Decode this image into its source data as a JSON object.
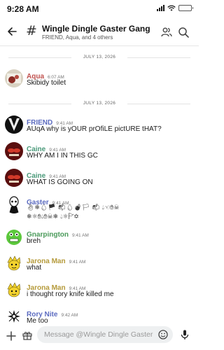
{
  "status": {
    "time": "9:28 AM"
  },
  "header": {
    "title": "Wingle Dingle Gaster Gang",
    "subtitle": "FRIEND, Aqua, and 4 others"
  },
  "dividers": [
    "JULY 13, 2026",
    "JULY 13, 2026"
  ],
  "messages": [
    {
      "author": "Aqua",
      "time": "6:07 AM",
      "text": "Skibidy toilet",
      "color": "#c0504d"
    },
    {
      "author": "FRIEND",
      "time": "9:41 AM",
      "text": "AUqA why is yOUR prOfiLE pictURE tHAT?",
      "color": "#5b6bc0"
    },
    {
      "author": "Caine",
      "time": "9:41 AM",
      "text": "WHY AM I IN THIS GC",
      "color": "#4a9a7a"
    },
    {
      "author": "Caine",
      "time": "9:41 AM",
      "text": "WHAT IS GOING ON",
      "color": "#4a9a7a"
    },
    {
      "author": "Gaster",
      "time": "9:41 AM",
      "text": "👌︎❄︎💧︎🏴︎ 📬︎💧︎💣︎🏳︎ 📬︎ 💧︎☜︎✋︎☠︎",
      "text2": "❄︎☼︎✋︎💧︎✋︎☠︎❄︎ 💧︎☼︎🏱︎✡︎",
      "color": "#5b6bc0"
    },
    {
      "author": "Gnarpington",
      "time": "9:41 AM",
      "text": "breh",
      "color": "#4a9a5a"
    },
    {
      "author": "Jarona Man",
      "time": "9:41 AM",
      "text": "what",
      "color": "#b59a3a"
    },
    {
      "author": "Jarona Man",
      "time": "9:41 AM",
      "text": "i thought rory knife killed me",
      "color": "#b59a3a"
    },
    {
      "author": "Rory Nite",
      "time": "9:42 AM",
      "text": "Me too",
      "color": "#5b6bc0"
    }
  ],
  "input": {
    "placeholder": "Message @Wingle Dingle Gaster"
  },
  "colors": {
    "battery_low": "#e53935",
    "divider": "#e3e3e3",
    "input_bg": "#eef0f1"
  }
}
